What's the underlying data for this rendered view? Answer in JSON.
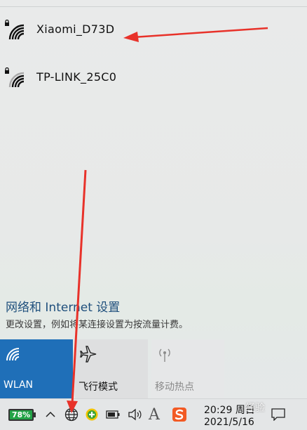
{
  "networks": [
    {
      "name": "Xiaomi_D73D",
      "icon": "wifi-secured-icon",
      "signal": "strong"
    },
    {
      "name": "TP-LINK_25C0",
      "icon": "wifi-secured-icon",
      "signal": "medium"
    }
  ],
  "settings": {
    "link": "网络和 Internet 设置",
    "description": "更改设置，例如将某连接设置为按流量计费。"
  },
  "tiles": [
    {
      "label": "WLAN",
      "icon": "wifi-icon",
      "active": true
    },
    {
      "label": "飞行模式",
      "icon": "airplane-icon",
      "active": false
    },
    {
      "label": "移动热点",
      "icon": "hotspot-icon",
      "active": false
    }
  ],
  "taskbar": {
    "battery_percent": "78%",
    "clock_time": "20:29",
    "clock_day": "周日",
    "clock_date": "2021/5/16",
    "ime_label": "A",
    "icons": [
      "chevron-up-icon",
      "globe-network-icon",
      "green-plus-icon",
      "battery-icon",
      "speaker-icon",
      "ime-icon",
      "sogou-icon",
      "notification-icon"
    ]
  },
  "watermark": "经验",
  "colors": {
    "accent": "#1f6fb8",
    "link": "#1e4f7c",
    "arrow": "#e8322a",
    "battery": "#23a347"
  }
}
